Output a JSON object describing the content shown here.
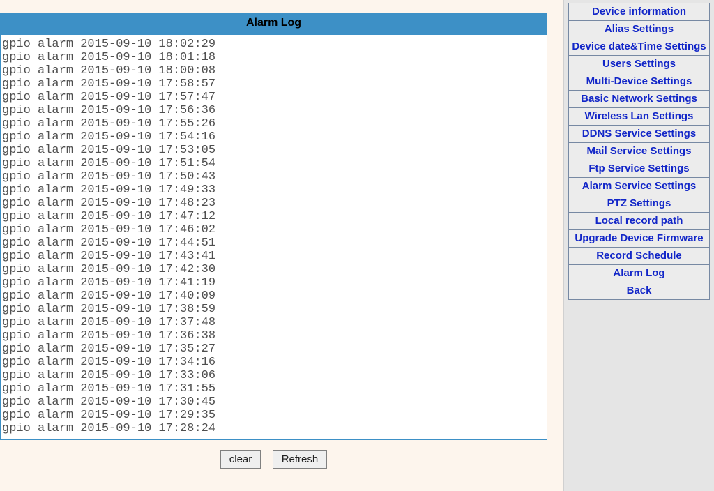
{
  "main": {
    "title": "Alarm Log",
    "log_entries": [
      "gpio alarm 2015-09-10 18:02:29",
      "gpio alarm 2015-09-10 18:01:18",
      "gpio alarm 2015-09-10 18:00:08",
      "gpio alarm 2015-09-10 17:58:57",
      "gpio alarm 2015-09-10 17:57:47",
      "gpio alarm 2015-09-10 17:56:36",
      "gpio alarm 2015-09-10 17:55:26",
      "gpio alarm 2015-09-10 17:54:16",
      "gpio alarm 2015-09-10 17:53:05",
      "gpio alarm 2015-09-10 17:51:54",
      "gpio alarm 2015-09-10 17:50:43",
      "gpio alarm 2015-09-10 17:49:33",
      "gpio alarm 2015-09-10 17:48:23",
      "gpio alarm 2015-09-10 17:47:12",
      "gpio alarm 2015-09-10 17:46:02",
      "gpio alarm 2015-09-10 17:44:51",
      "gpio alarm 2015-09-10 17:43:41",
      "gpio alarm 2015-09-10 17:42:30",
      "gpio alarm 2015-09-10 17:41:19",
      "gpio alarm 2015-09-10 17:40:09",
      "gpio alarm 2015-09-10 17:38:59",
      "gpio alarm 2015-09-10 17:37:48",
      "gpio alarm 2015-09-10 17:36:38",
      "gpio alarm 2015-09-10 17:35:27",
      "gpio alarm 2015-09-10 17:34:16",
      "gpio alarm 2015-09-10 17:33:06",
      "gpio alarm 2015-09-10 17:31:55",
      "gpio alarm 2015-09-10 17:30:45",
      "gpio alarm 2015-09-10 17:29:35",
      "gpio alarm 2015-09-10 17:28:24"
    ],
    "clear_label": "clear",
    "refresh_label": "Refresh"
  },
  "sidebar": {
    "items": [
      "Device information",
      "Alias Settings",
      "Device date&Time Settings",
      "Users Settings",
      "Multi-Device Settings",
      "Basic Network Settings",
      "Wireless Lan Settings",
      "DDNS Service Settings",
      "Mail Service Settings",
      "Ftp Service Settings",
      "Alarm Service Settings",
      "PTZ Settings",
      "Local record path",
      "Upgrade Device Firmware",
      "Record Schedule",
      "Alarm Log",
      "Back"
    ]
  }
}
